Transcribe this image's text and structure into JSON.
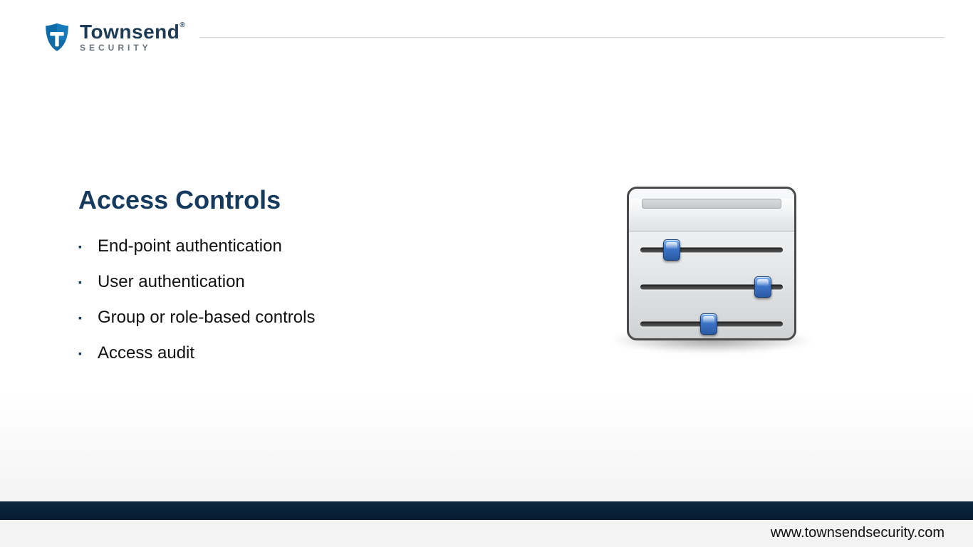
{
  "header": {
    "brand": "Townsend",
    "subbrand": "SECURITY",
    "trademark_symbol": "®"
  },
  "main": {
    "title": "Access Controls",
    "bullets": [
      "End-point authentication",
      "User authentication",
      "Group or role-based controls",
      "Access audit"
    ]
  },
  "illustration": {
    "name": "settings-sliders-panel",
    "slider_positions_pct": [
      22,
      86,
      48
    ]
  },
  "footer": {
    "url": "www.townsendsecurity.com"
  },
  "colors": {
    "brand_navy": "#153a5d",
    "footer_bg": "#0d2841",
    "knob_blue": "#3d74c7"
  }
}
